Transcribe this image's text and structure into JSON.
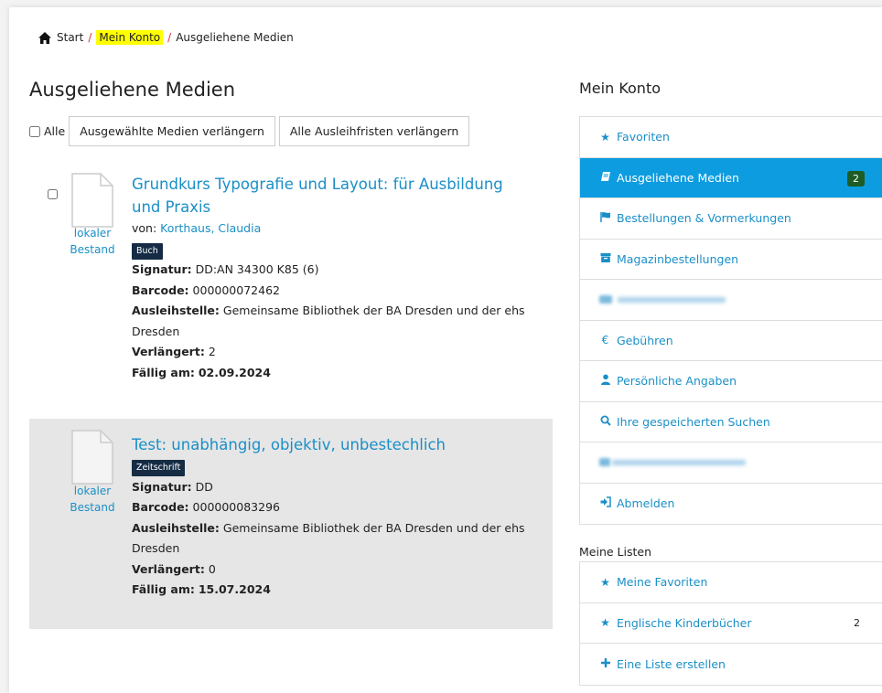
{
  "breadcrumb": {
    "home": "Start",
    "account": "Mein Konto",
    "current": "Ausgeliehene Medien"
  },
  "page_title": "Ausgeliehene Medien",
  "toolbar": {
    "select_all": "Alle",
    "renew_selected": "Ausgewählte Medien verlängern",
    "renew_all": "Alle Ausleihfristen verlängern"
  },
  "items": [
    {
      "title": "Grundkurs Typografie und Layout: für Ausbildung und Praxis",
      "author_label": "von:",
      "author": "Korthaus, Claudia",
      "holding": "lokaler Bestand",
      "format": "Buch",
      "signatur_label": "Signatur:",
      "signatur": "DD:AN 34300 K85 (6)",
      "barcode_label": "Barcode:",
      "barcode": "000000072462",
      "location_label": "Ausleihstelle:",
      "location": "Gemeinsame Bibliothek der BA Dresden und der ehs Dresden",
      "renewed_label": "Verlängert:",
      "renewed": "2",
      "due_label": "Fällig am:",
      "due": "02.09.2024"
    },
    {
      "title": "Test: unabhängig, objektiv, unbestechlich",
      "holding": "lokaler Bestand",
      "format": "Zeitschrift",
      "signatur_label": "Signatur:",
      "signatur": "DD",
      "barcode_label": "Barcode:",
      "barcode": "000000083296",
      "location_label": "Ausleihstelle:",
      "location": "Gemeinsame Bibliothek der BA Dresden und der ehs Dresden",
      "renewed_label": "Verlängert:",
      "renewed": "0",
      "due_label": "Fällig am:",
      "due": "15.07.2024"
    }
  ],
  "sidebar": {
    "title": "Mein Konto",
    "items": [
      {
        "label": "Favoriten",
        "icon": "star-icon"
      },
      {
        "label": "Ausgeliehene Medien",
        "icon": "book-icon",
        "count": "2",
        "active": true
      },
      {
        "label": "Bestellungen & Vormerkungen",
        "icon": "flag-icon"
      },
      {
        "label": "Magazinbestellungen",
        "icon": "archive-icon"
      },
      {
        "label": "",
        "icon": "blurred-icon",
        "blurred": true
      },
      {
        "label": "Gebühren",
        "icon": "euro-icon"
      },
      {
        "label": "Persönliche Angaben",
        "icon": "user-icon"
      },
      {
        "label": "Ihre gespeicherten Suchen",
        "icon": "search-icon"
      },
      {
        "label": "",
        "icon": "blurred-icon",
        "blurred": true
      },
      {
        "label": "Abmelden",
        "icon": "sign-out-icon"
      }
    ],
    "lists_title": "Meine Listen",
    "lists": [
      {
        "label": "Meine Favoriten",
        "icon": "star-icon"
      },
      {
        "label": "Englische Kinderbücher",
        "icon": "star-icon",
        "count": "2"
      },
      {
        "label": "Eine Liste erstellen",
        "icon": "plus-icon"
      }
    ]
  },
  "colors": {
    "link": "#1a8fc7",
    "active": "#0d9ce0",
    "badge": "#152c44",
    "count": "#1d5c25",
    "highlight": "#ffff00"
  }
}
